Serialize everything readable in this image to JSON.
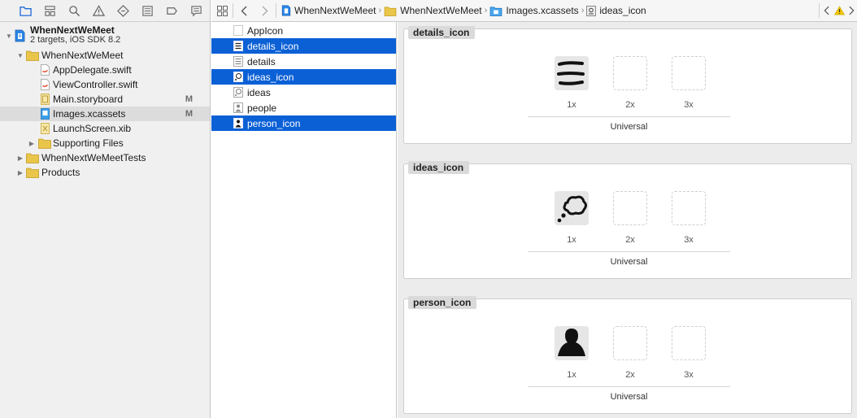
{
  "navigator": {
    "tabs": [
      "folder-icon",
      "hierarchy-icon",
      "search-icon",
      "warning-icon",
      "test-diamond-icon",
      "debug-icon",
      "breakpoint-icon",
      "report-icon"
    ],
    "project": {
      "name": "WhenNextWeMeet",
      "subtitle": "2 targets, iOS SDK 8.2"
    },
    "items": [
      {
        "label": "WhenNextWeMeet",
        "type": "folder",
        "level": 1,
        "disclosure": "open"
      },
      {
        "label": "AppDelegate.swift",
        "type": "swift",
        "level": 2,
        "status": ""
      },
      {
        "label": "ViewController.swift",
        "type": "swift",
        "level": 2,
        "status": ""
      },
      {
        "label": "Main.storyboard",
        "type": "storyboard",
        "level": 2,
        "status": "M"
      },
      {
        "label": "Images.xcassets",
        "type": "xcassets",
        "level": 2,
        "status": "M",
        "selected": true
      },
      {
        "label": "LaunchScreen.xib",
        "type": "xib",
        "level": 2,
        "status": ""
      },
      {
        "label": "Supporting Files",
        "type": "folder",
        "level": 2,
        "disclosure": "closed"
      },
      {
        "label": "WhenNextWeMeetTests",
        "type": "folder",
        "level": 1,
        "disclosure": "closed"
      },
      {
        "label": "Products",
        "type": "folder",
        "level": 1,
        "disclosure": "closed"
      }
    ]
  },
  "jumpbar": {
    "crumbs": [
      "WhenNextWeMeet",
      "WhenNextWeMeet",
      "Images.xcassets",
      "ideas_icon"
    ]
  },
  "asset_list": [
    {
      "name": "AppIcon",
      "selected": false
    },
    {
      "name": "details_icon",
      "selected": true
    },
    {
      "name": "details",
      "selected": false
    },
    {
      "name": "ideas_icon",
      "selected": true
    },
    {
      "name": "ideas",
      "selected": false
    },
    {
      "name": "people",
      "selected": false
    },
    {
      "name": "person_icon",
      "selected": true
    }
  ],
  "image_sets": [
    {
      "name": "details_icon",
      "icon": "details-lines-icon",
      "scales": [
        "1x",
        "2x",
        "3x"
      ],
      "idiom": "Universal"
    },
    {
      "name": "ideas_icon",
      "icon": "thought-bubble-icon",
      "scales": [
        "1x",
        "2x",
        "3x"
      ],
      "idiom": "Universal"
    },
    {
      "name": "person_icon",
      "icon": "person-silhouette-icon",
      "scales": [
        "1x",
        "2x",
        "3x"
      ],
      "idiom": "Universal"
    }
  ],
  "colors": {
    "selection_blue": "#0b60d6",
    "folder_yellow": "#e9c64a",
    "warning_yellow": "#f2c500"
  }
}
